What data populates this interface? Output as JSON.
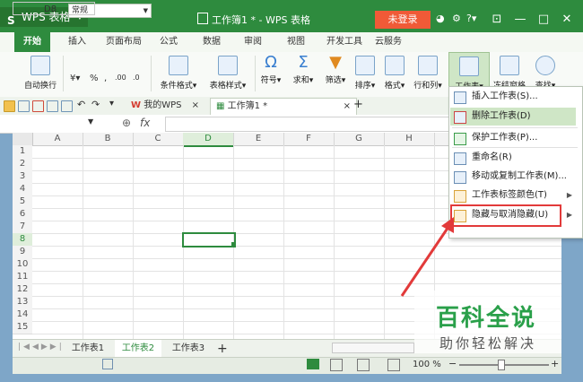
{
  "app": {
    "logo_text": "WPS 表格",
    "doc_title": "工作簿1 * - WPS 表格",
    "login_label": "未登录",
    "help_label": "?"
  },
  "ribbon_tabs": [
    "开始",
    "插入",
    "页面布局",
    "公式",
    "数据",
    "审阅",
    "视图",
    "开发工具",
    "云服务"
  ],
  "ribbon": {
    "auto_wrap": "自动换行",
    "font_value": "常规",
    "percent": "%",
    "decimal_inc": ".00",
    "decimal_dec": ".0",
    "cond_format": "条件格式",
    "table_style": "表格样式",
    "symbol": "符号",
    "sum": "求和",
    "filter": "筛选",
    "sort": "排序",
    "format": "格式",
    "row_col": "行和列",
    "worksheet": "工作表",
    "freeze": "冻结窗格",
    "find": "查找"
  },
  "quickbar": {
    "my_wps": "我的WPS",
    "doc_tab": "工作簿1 *",
    "new_tab": "+"
  },
  "formula": {
    "cell_ref": "D8",
    "fx": "fx"
  },
  "grid": {
    "columns": [
      "A",
      "B",
      "C",
      "D",
      "E",
      "F",
      "G",
      "H"
    ],
    "rows": [
      "1",
      "2",
      "3",
      "4",
      "5",
      "6",
      "7",
      "8",
      "9",
      "10",
      "11",
      "12",
      "13",
      "14",
      "15"
    ],
    "selected_cell": "D8"
  },
  "sheets": [
    "工作表1",
    "工作表2",
    "工作表3"
  ],
  "active_sheet_index": 1,
  "status": {
    "zoom": "100 %"
  },
  "worksheet_menu": {
    "items": [
      {
        "label": "插入工作表(S)...",
        "submenu": false
      },
      {
        "label": "删除工作表(D)",
        "submenu": false
      },
      {
        "label": "保护工作表(P)...",
        "submenu": false
      },
      {
        "label": "重命名(R)",
        "submenu": false
      },
      {
        "label": "移动或复制工作表(M)...",
        "submenu": false
      },
      {
        "label": "工作表标签颜色(T)",
        "submenu": true
      },
      {
        "label": "隐藏与取消隐藏(U)",
        "submenu": true
      }
    ],
    "hovered_index": 1,
    "highlighted_index": 6
  },
  "watermark": {
    "title": "百科全说",
    "subtitle": "助你轻松解决"
  },
  "colors": {
    "brand_green": "#2e8b3e",
    "login_orange": "#f05a37",
    "highlight_red": "#e23a3a"
  }
}
